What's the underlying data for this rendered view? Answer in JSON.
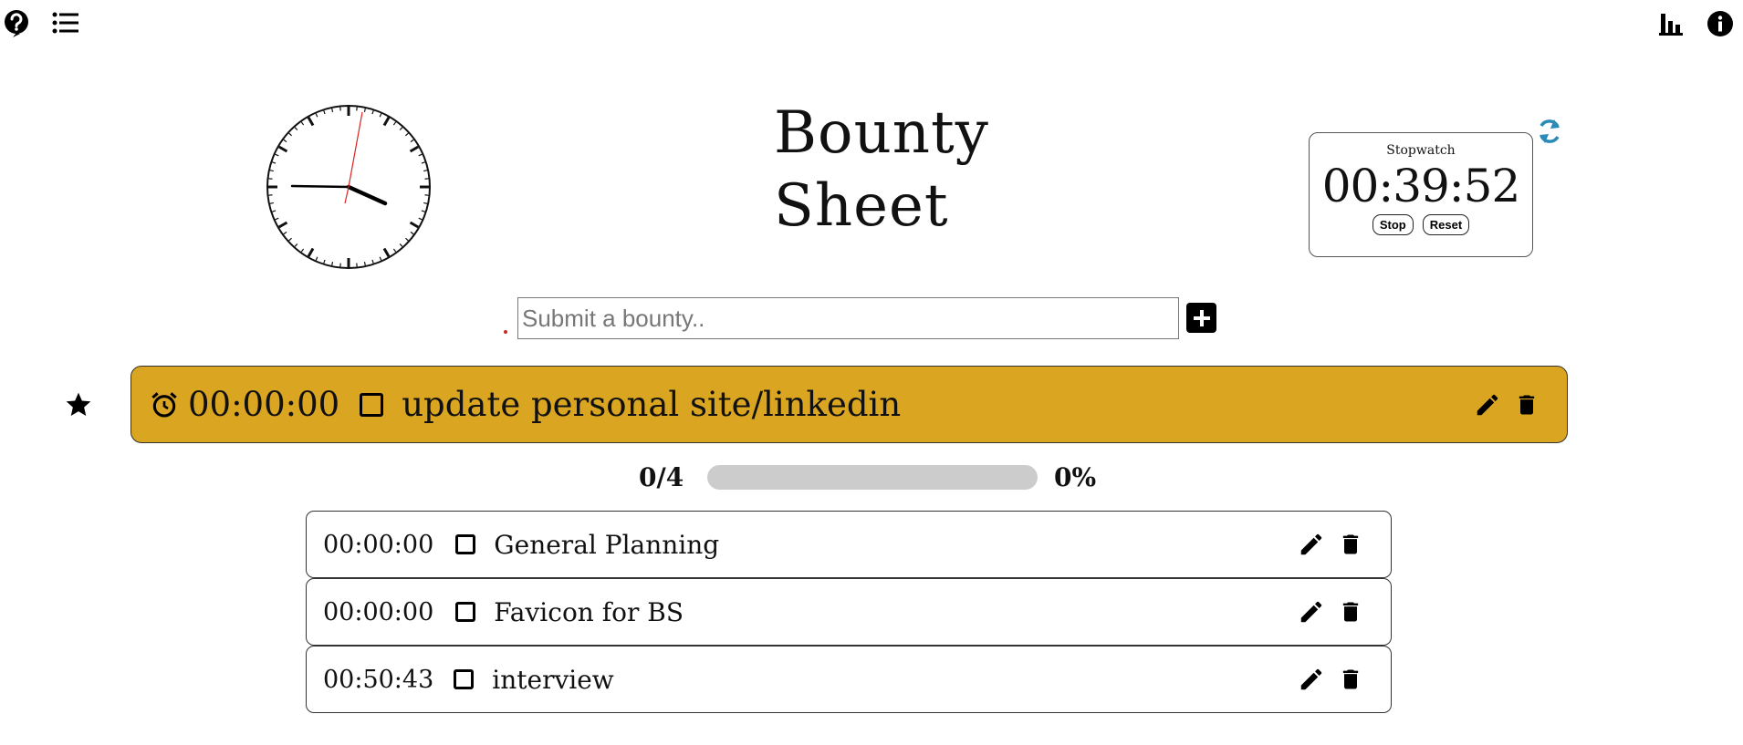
{
  "header": {
    "left_icons": [
      "help-icon",
      "list-icon"
    ],
    "right_icons": [
      "bar-chart-icon",
      "info-icon"
    ]
  },
  "title": {
    "line1": "Bounty",
    "line2": "Sheet"
  },
  "stopwatch": {
    "label": "Stopwatch",
    "time": "00:39:52",
    "stop_label": "Stop",
    "reset_label": "Reset",
    "refresh_icon": "refresh-icon",
    "refresh_color": "#2a8ab8"
  },
  "submit": {
    "placeholder": "Submit a bounty..",
    "value": ""
  },
  "main_bounty": {
    "time": "00:00:00",
    "text": "update personal site/linkedin",
    "color": "#daa520",
    "icons": [
      "star-icon",
      "alarm-icon",
      "edit-icon",
      "trash-icon"
    ]
  },
  "progress": {
    "count": "0/4",
    "percent_label": "0%",
    "fraction": 0
  },
  "subtasks": [
    {
      "time": "00:00:00",
      "text": "General Planning"
    },
    {
      "time": "00:00:00",
      "text": "Favicon for BS"
    },
    {
      "time": "00:50:43",
      "text": "interview"
    }
  ]
}
